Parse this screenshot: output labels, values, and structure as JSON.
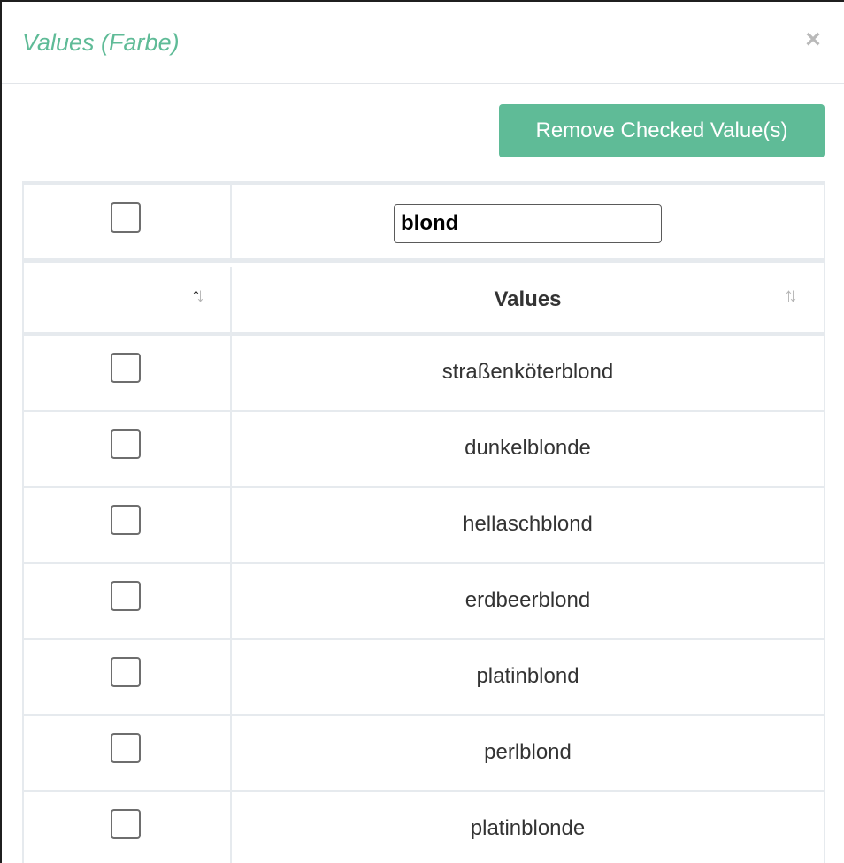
{
  "modal": {
    "title": "Values (Farbe)",
    "close_label": "×"
  },
  "toolbar": {
    "remove_label": "Remove Checked Value(s)"
  },
  "table": {
    "filter_value": "blond",
    "header_value_label": "Values",
    "rows": [
      {
        "value": "straßenköterblond",
        "checked": false
      },
      {
        "value": "dunkelblonde",
        "checked": false
      },
      {
        "value": "hellaschblond",
        "checked": false
      },
      {
        "value": "erdbeerblond",
        "checked": false
      },
      {
        "value": "platinblond",
        "checked": false
      },
      {
        "value": "perlblond",
        "checked": false
      },
      {
        "value": "platinblonde",
        "checked": false
      }
    ]
  },
  "colors": {
    "accent": "#5fbb97",
    "border": "#e6eaee",
    "text": "#333333"
  },
  "icons": {
    "close": "close-icon",
    "sort_check_column": "sort-icon",
    "sort_value_column": "sort-icon"
  }
}
